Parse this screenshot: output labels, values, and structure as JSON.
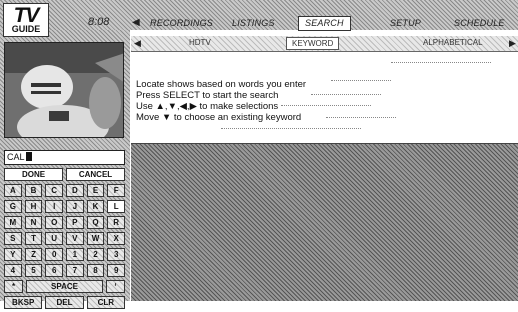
{
  "header": {
    "logo_top": "TV",
    "logo_bottom": "GUIDE",
    "clock": "8:08",
    "nav": [
      "RECORDINGS",
      "LISTINGS",
      "SEARCH",
      "SETUP",
      "SCHEDULE"
    ]
  },
  "tabs": {
    "items": [
      "HDTV",
      "KEYWORD",
      "ALPHABETICAL"
    ],
    "active": "KEYWORD"
  },
  "info": {
    "lines": [
      "Locate shows based on words you enter",
      "Press SELECT to start the search",
      "Use ▲,▼,◀,▶ to make selections",
      "Move ▼ to choose an existing keyword"
    ]
  },
  "entry": {
    "value": "CAL"
  },
  "keypad": {
    "done": "DONE",
    "cancel": "CANCEL",
    "rows": [
      [
        "A",
        "B",
        "C",
        "D",
        "E",
        "F"
      ],
      [
        "G",
        "H",
        "I",
        "J",
        "K",
        "L"
      ],
      [
        "M",
        "N",
        "O",
        "P",
        "Q",
        "R"
      ],
      [
        "S",
        "T",
        "U",
        "V",
        "W",
        "X"
      ],
      [
        "Y",
        "Z",
        "0",
        "1",
        "2",
        "3"
      ],
      [
        "4",
        "5",
        "6",
        "7",
        "8",
        "9"
      ]
    ],
    "space_row_left": "*",
    "space": "SPACE",
    "space_row_right": "‘",
    "bksp": "BKSP",
    "del": "DEL",
    "clr": "CLR"
  }
}
